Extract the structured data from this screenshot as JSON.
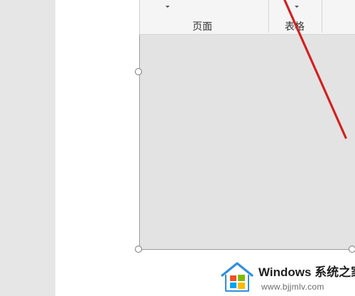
{
  "ribbon": {
    "groups": [
      {
        "label": "页面"
      },
      {
        "label": "表格"
      }
    ]
  },
  "watermark": {
    "title": "Windows 系统之家",
    "url": "www.bjjmlv.com"
  },
  "colors": {
    "annotation_line": "#d42020",
    "canvas_gray": "#e3e3e3",
    "ribbon_bg": "#f5f5f5"
  }
}
